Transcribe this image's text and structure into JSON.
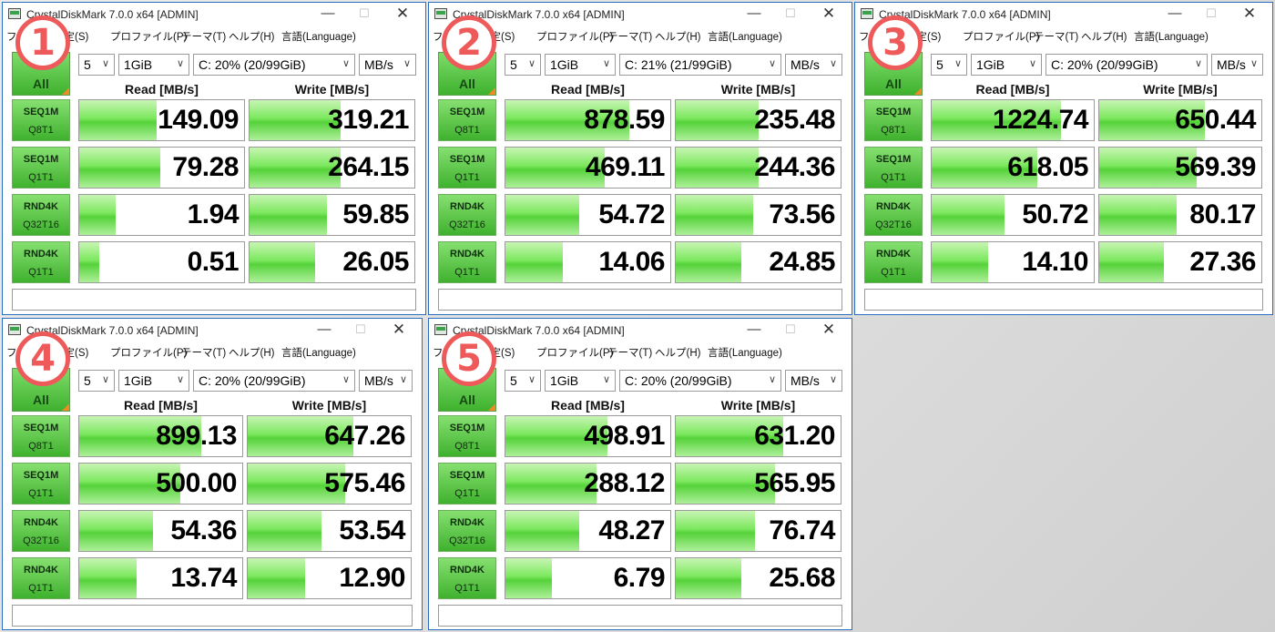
{
  "app_title": "CrystalDiskMark 7.0.0 x64 [ADMIN]",
  "titlebar_controls": {
    "minimize": "—",
    "maximize": "☐",
    "close": "✕"
  },
  "menu_items": [
    "ファイル(F)",
    "設定(S)",
    "プロファイル(P)",
    "テーマ(T)",
    "ヘルプ(H)",
    "言語(Language)"
  ],
  "all_button": "All",
  "headers": {
    "read": "Read [MB/s]",
    "write": "Write [MB/s]"
  },
  "rows": [
    {
      "l1": "SEQ1M",
      "l2": "Q8T1"
    },
    {
      "l1": "SEQ1M",
      "l2": "Q1T1"
    },
    {
      "l1": "RND4K",
      "l2": "Q32T16"
    },
    {
      "l1": "RND4K",
      "l2": "Q1T1"
    }
  ],
  "windows": [
    {
      "badge": "1",
      "count": "5",
      "size": "1GiB",
      "drive": "C: 20% (20/99GiB)",
      "unit": "MB/s",
      "read": [
        "149.09",
        "79.28",
        "1.94",
        "0.51"
      ],
      "write": [
        "319.21",
        "264.15",
        "59.85",
        "26.05"
      ],
      "read_fill": [
        0.47,
        0.49,
        0.22,
        0.12
      ],
      "write_fill": [
        0.55,
        0.55,
        0.47,
        0.4
      ]
    },
    {
      "badge": "2",
      "count": "5",
      "size": "1GiB",
      "drive": "C: 21% (21/99GiB)",
      "unit": "MB/s",
      "read": [
        "878.59",
        "469.11",
        "54.72",
        "14.06"
      ],
      "write": [
        "235.48",
        "244.36",
        "73.56",
        "24.85"
      ],
      "read_fill": [
        0.75,
        0.6,
        0.45,
        0.35
      ],
      "write_fill": [
        0.5,
        0.5,
        0.47,
        0.4
      ]
    },
    {
      "badge": "3",
      "count": "5",
      "size": "1GiB",
      "drive": "C: 20% (20/99GiB)",
      "unit": "MB/s",
      "read": [
        "1224.74",
        "618.05",
        "50.72",
        "14.10"
      ],
      "write": [
        "650.44",
        "569.39",
        "80.17",
        "27.36"
      ],
      "read_fill": [
        0.8,
        0.65,
        0.45,
        0.35
      ],
      "write_fill": [
        0.65,
        0.6,
        0.48,
        0.4
      ]
    },
    {
      "badge": "4",
      "count": "5",
      "size": "1GiB",
      "drive": "C: 20% (20/99GiB)",
      "unit": "MB/s",
      "read": [
        "899.13",
        "500.00",
        "54.36",
        "13.74"
      ],
      "write": [
        "647.26",
        "575.46",
        "53.54",
        "12.90"
      ],
      "read_fill": [
        0.75,
        0.62,
        0.45,
        0.35
      ],
      "write_fill": [
        0.65,
        0.6,
        0.45,
        0.35
      ]
    },
    {
      "badge": "5",
      "count": "5",
      "size": "1GiB",
      "drive": "C: 20% (20/99GiB)",
      "unit": "MB/s",
      "read": [
        "498.91",
        "288.12",
        "48.27",
        "6.79"
      ],
      "write": [
        "631.20",
        "565.95",
        "76.74",
        "25.68"
      ],
      "read_fill": [
        0.62,
        0.55,
        0.45,
        0.28
      ],
      "write_fill": [
        0.65,
        0.6,
        0.48,
        0.4
      ]
    }
  ]
}
